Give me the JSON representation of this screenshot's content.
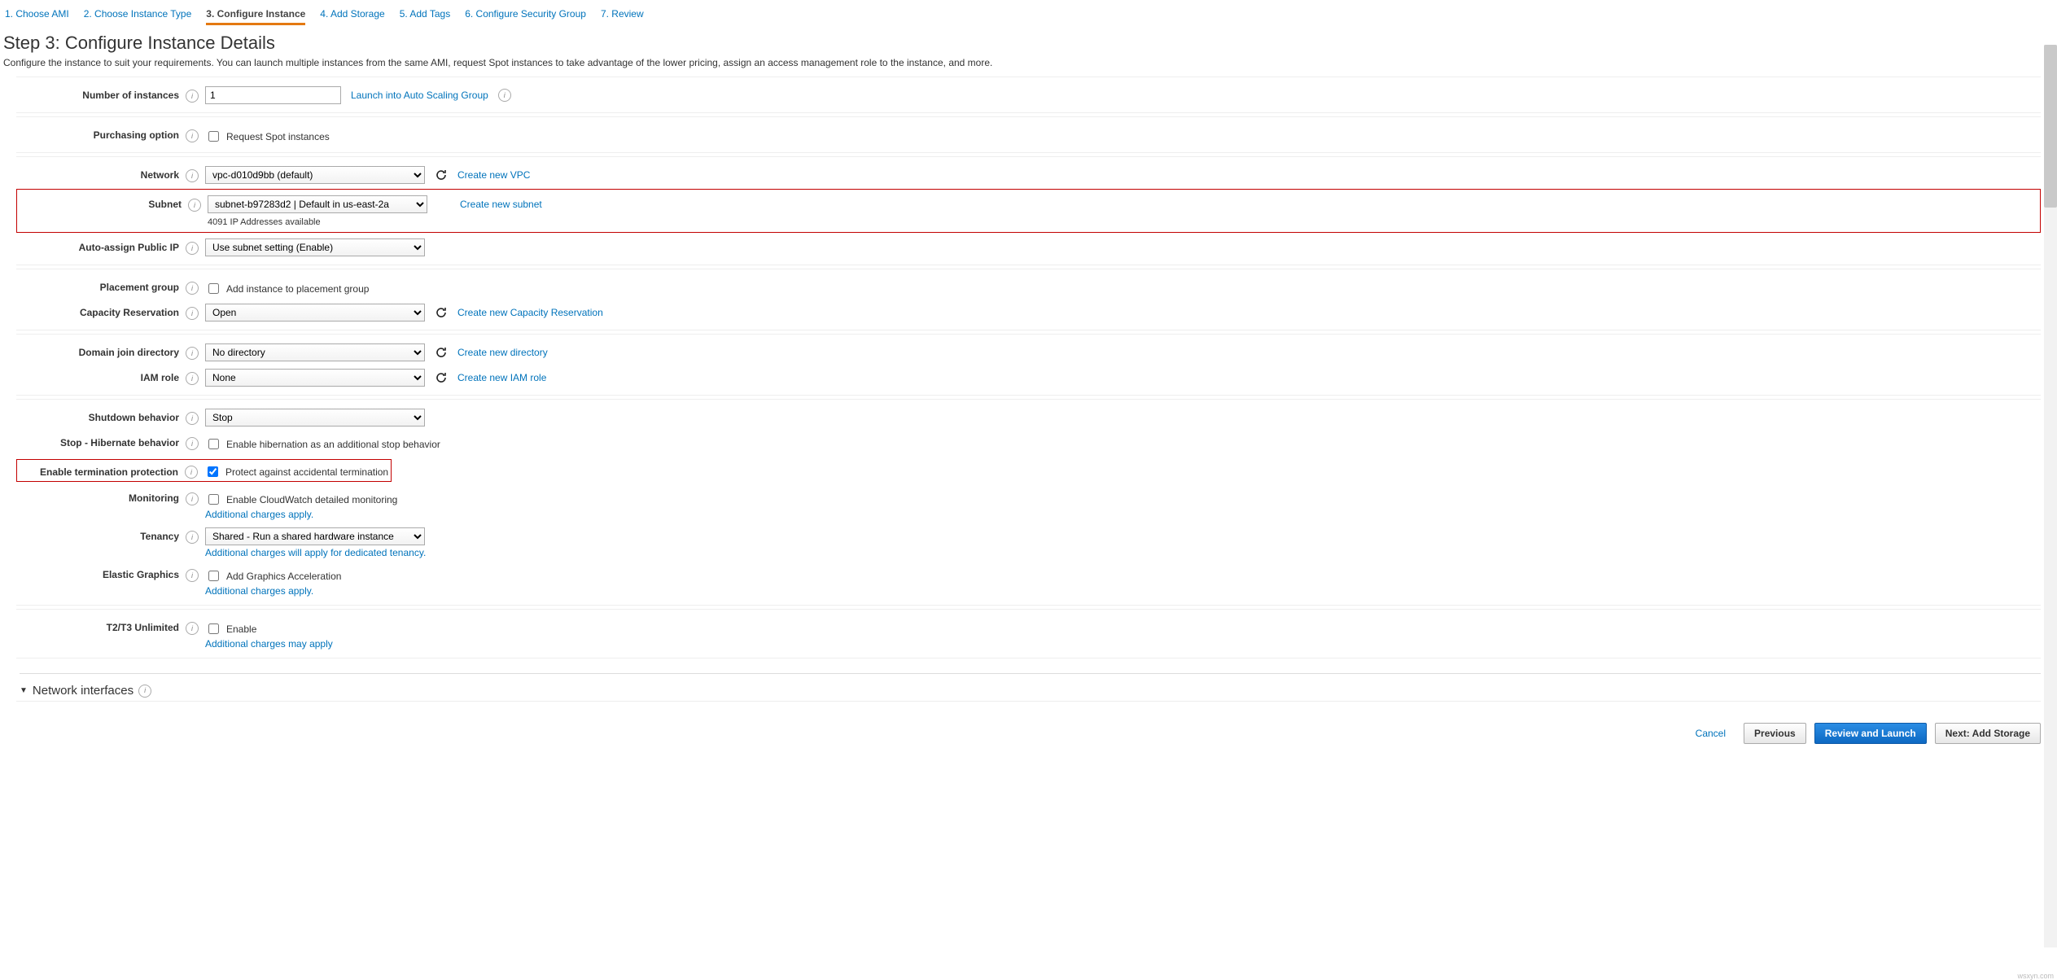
{
  "tabs": [
    "1. Choose AMI",
    "2. Choose Instance Type",
    "3. Configure Instance",
    "4. Add Storage",
    "5. Add Tags",
    "6. Configure Security Group",
    "7. Review"
  ],
  "active_tab": 2,
  "title": "Step 3: Configure Instance Details",
  "subtitle": "Configure the instance to suit your requirements. You can launch multiple instances from the same AMI, request Spot instances to take advantage of the lower pricing, assign an access management role to the instance, and more.",
  "fields": {
    "instances": {
      "label": "Number of instances",
      "value": "1",
      "link": "Launch into Auto Scaling Group"
    },
    "purchasing": {
      "label": "Purchasing option",
      "cb": "Request Spot instances"
    },
    "network": {
      "label": "Network",
      "value": "vpc-d010d9bb (default)",
      "link": "Create new VPC"
    },
    "subnet": {
      "label": "Subnet",
      "value": "subnet-b97283d2 | Default in us-east-2a",
      "sub": "4091 IP Addresses available",
      "link": "Create new subnet"
    },
    "publicip": {
      "label": "Auto-assign Public IP",
      "value": "Use subnet setting (Enable)"
    },
    "placement": {
      "label": "Placement group",
      "cb": "Add instance to placement group"
    },
    "capacity": {
      "label": "Capacity Reservation",
      "value": "Open",
      "link": "Create new Capacity Reservation"
    },
    "domain": {
      "label": "Domain join directory",
      "value": "No directory",
      "link": "Create new directory"
    },
    "iam": {
      "label": "IAM role",
      "value": "None",
      "link": "Create new IAM role"
    },
    "shutdown": {
      "label": "Shutdown behavior",
      "value": "Stop"
    },
    "hibernate": {
      "label": "Stop - Hibernate behavior",
      "cb": "Enable hibernation as an additional stop behavior"
    },
    "termination": {
      "label": "Enable termination protection",
      "cb": "Protect against accidental termination"
    },
    "monitoring": {
      "label": "Monitoring",
      "cb": "Enable CloudWatch detailed monitoring",
      "link": "Additional charges apply."
    },
    "tenancy": {
      "label": "Tenancy",
      "value": "Shared - Run a shared hardware instance",
      "link": "Additional charges will apply for dedicated tenancy."
    },
    "elastic": {
      "label": "Elastic Graphics",
      "cb": "Add Graphics Acceleration",
      "link": "Additional charges apply."
    },
    "t2t3": {
      "label": "T2/T3 Unlimited",
      "cb": "Enable",
      "link": "Additional charges may apply"
    }
  },
  "section": "Network interfaces",
  "footer": {
    "cancel": "Cancel",
    "prev": "Previous",
    "review": "Review and Launch",
    "next": "Next: Add Storage"
  },
  "watermark": "wsxyn.com"
}
